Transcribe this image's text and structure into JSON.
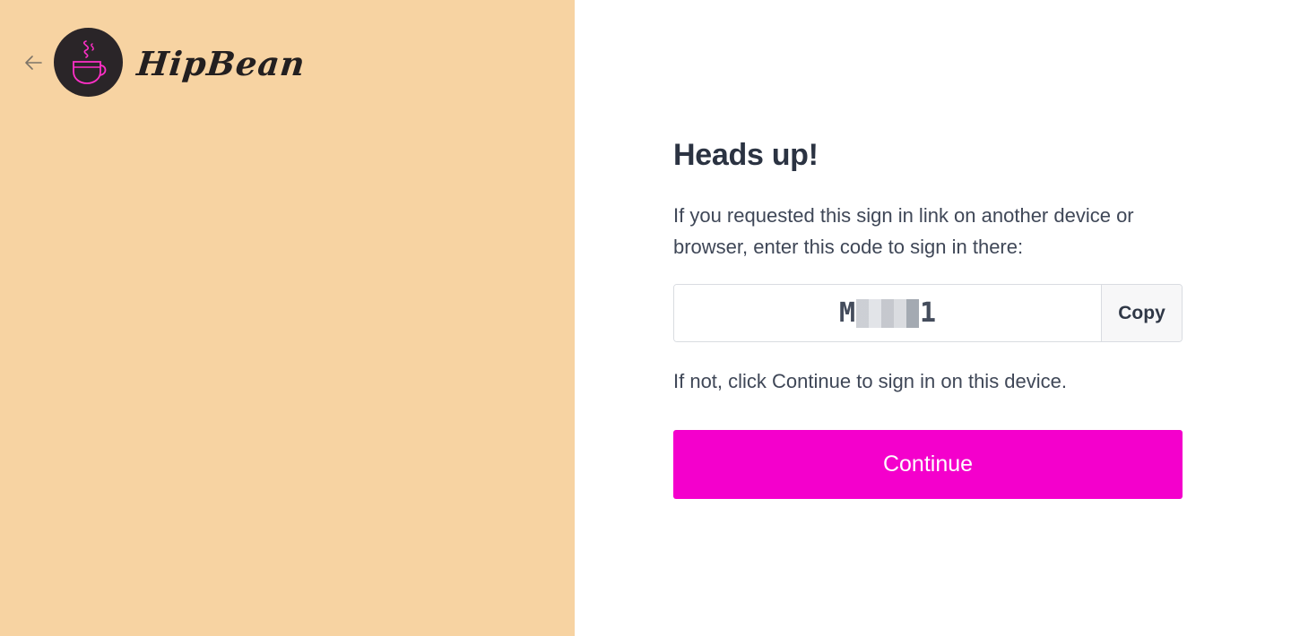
{
  "app": {
    "brand_name": "HipBean",
    "brand_color": "#f7d3a2",
    "accent_color": "#f400cc"
  },
  "nav": {
    "back_icon": "arrow-left-icon"
  },
  "logo": {
    "icon": "coffee-cup-icon"
  },
  "main": {
    "heading": "Heads up!",
    "intro_text": "If you requested this sign in link on another device or browser, enter this code to sign in there:",
    "code_prefix": "M",
    "code_suffix": "1",
    "copy_label": "Copy",
    "note_text": "If not, click Continue to sign in on this device.",
    "continue_label": "Continue"
  }
}
